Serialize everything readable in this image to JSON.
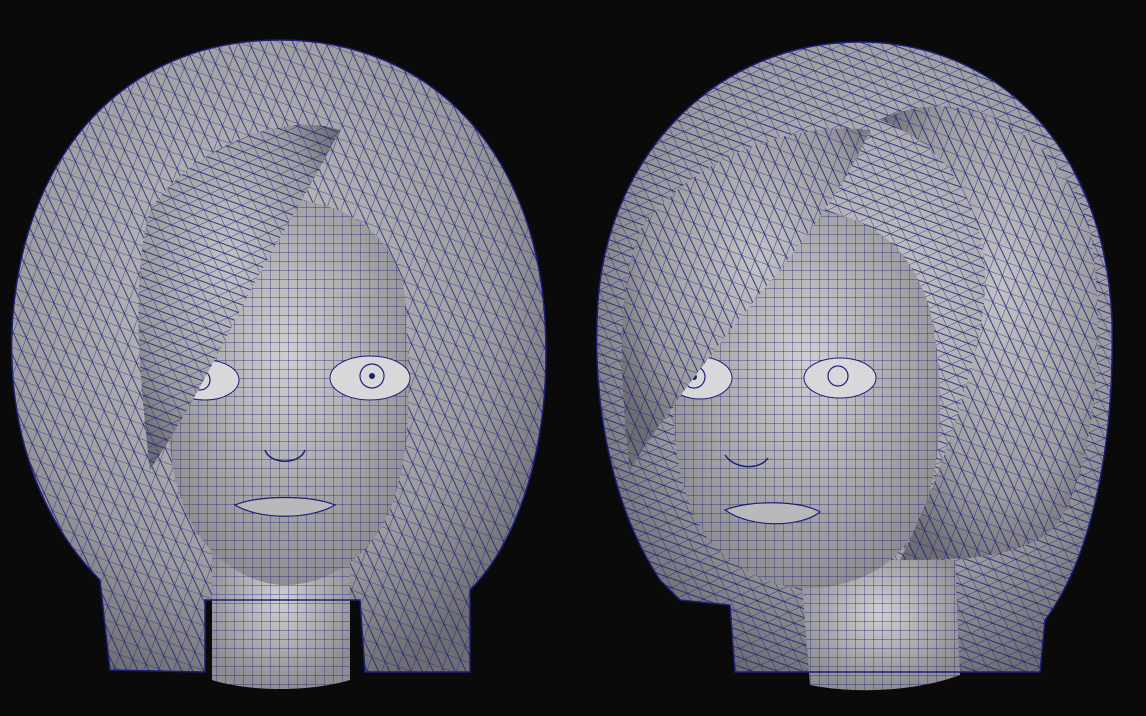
{
  "scene": {
    "background_color": "#0a0a0a",
    "surface_color": "#a7a7a9",
    "wire_color": "#1c1f7a",
    "views": [
      "front-view",
      "three-quarter-view"
    ]
  }
}
